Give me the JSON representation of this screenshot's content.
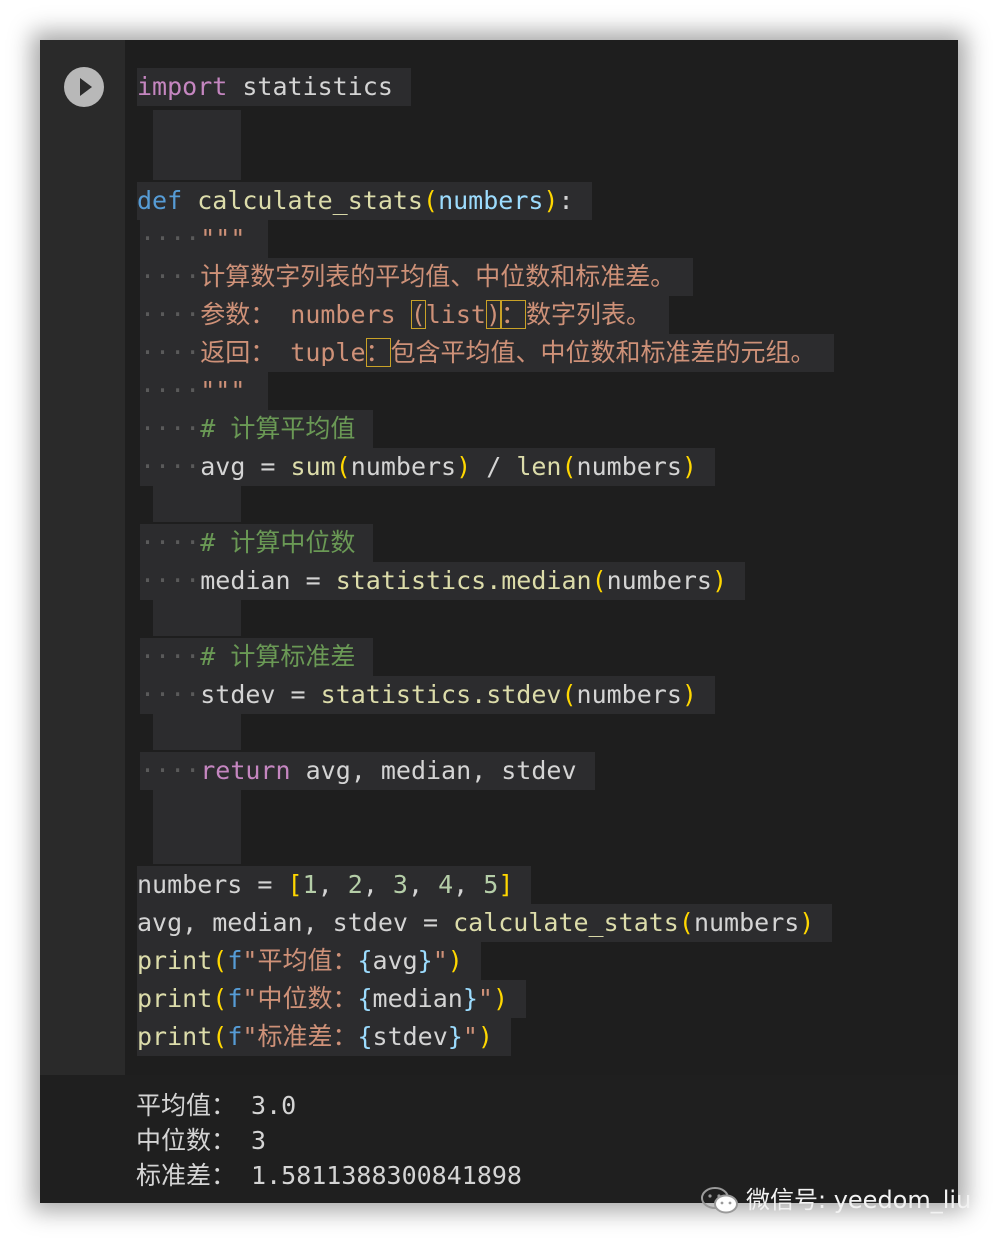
{
  "code": {
    "l1_import": "import",
    "l1_module": "statistics",
    "l2_def": "def",
    "l2_name": "calculate_stats",
    "l2_param": "numbers",
    "l3_quotes": "\"\"\"",
    "l4_doc": "计算数字列表的平均值、中位数和标准差。",
    "l5_doc_a": "参数： numbers ",
    "l5_doc_b": "(",
    "l5_doc_c": "list",
    "l5_doc_d": ")",
    "l5_doc_e": "：",
    "l5_doc_f": "数字列表。",
    "l6_doc_a": "返回： tuple",
    "l6_doc_b": "：",
    "l6_doc_c": "包含平均值、中位数和标准差的元组。",
    "l7_quotes": "\"\"\"",
    "l8_comment": "# 计算平均值",
    "l9_var": "avg",
    "l9_sum": "sum",
    "l9_arg1": "numbers",
    "l9_len": "len",
    "l9_arg2": "numbers",
    "l10_comment": "# 计算中位数",
    "l11_var": "median",
    "l11_call": "statistics.median",
    "l11_arg": "numbers",
    "l12_comment": "# 计算标准差",
    "l13_var": "stdev",
    "l13_call": "statistics.stdev",
    "l13_arg": "numbers",
    "l14_return": "return",
    "l14_vals": "avg, median, stdev",
    "l15_var": "numbers",
    "l15_n1": "1",
    "l15_n2": "2",
    "l15_n3": "3",
    "l15_n4": "4",
    "l15_n5": "5",
    "l16_vars": "avg, median, stdev",
    "l16_call": "calculate_stats",
    "l16_arg": "numbers",
    "l17_print": "print",
    "l17_f": "f",
    "l17_str": "\"平均值：",
    "l17_var": "avg",
    "l18_print": "print",
    "l18_f": "f",
    "l18_str": "\"中位数：",
    "l18_var": "median",
    "l19_print": "print",
    "l19_f": "f",
    "l19_str": "\"标准差：",
    "l19_var": "stdev"
  },
  "output": {
    "line1": "平均值： 3.0",
    "line2": "中位数： 3",
    "line3": "标准差： 1.5811388300841898"
  },
  "watermark": {
    "text": "微信号: yeedom_liu",
    "icon": "wechat-icon"
  }
}
